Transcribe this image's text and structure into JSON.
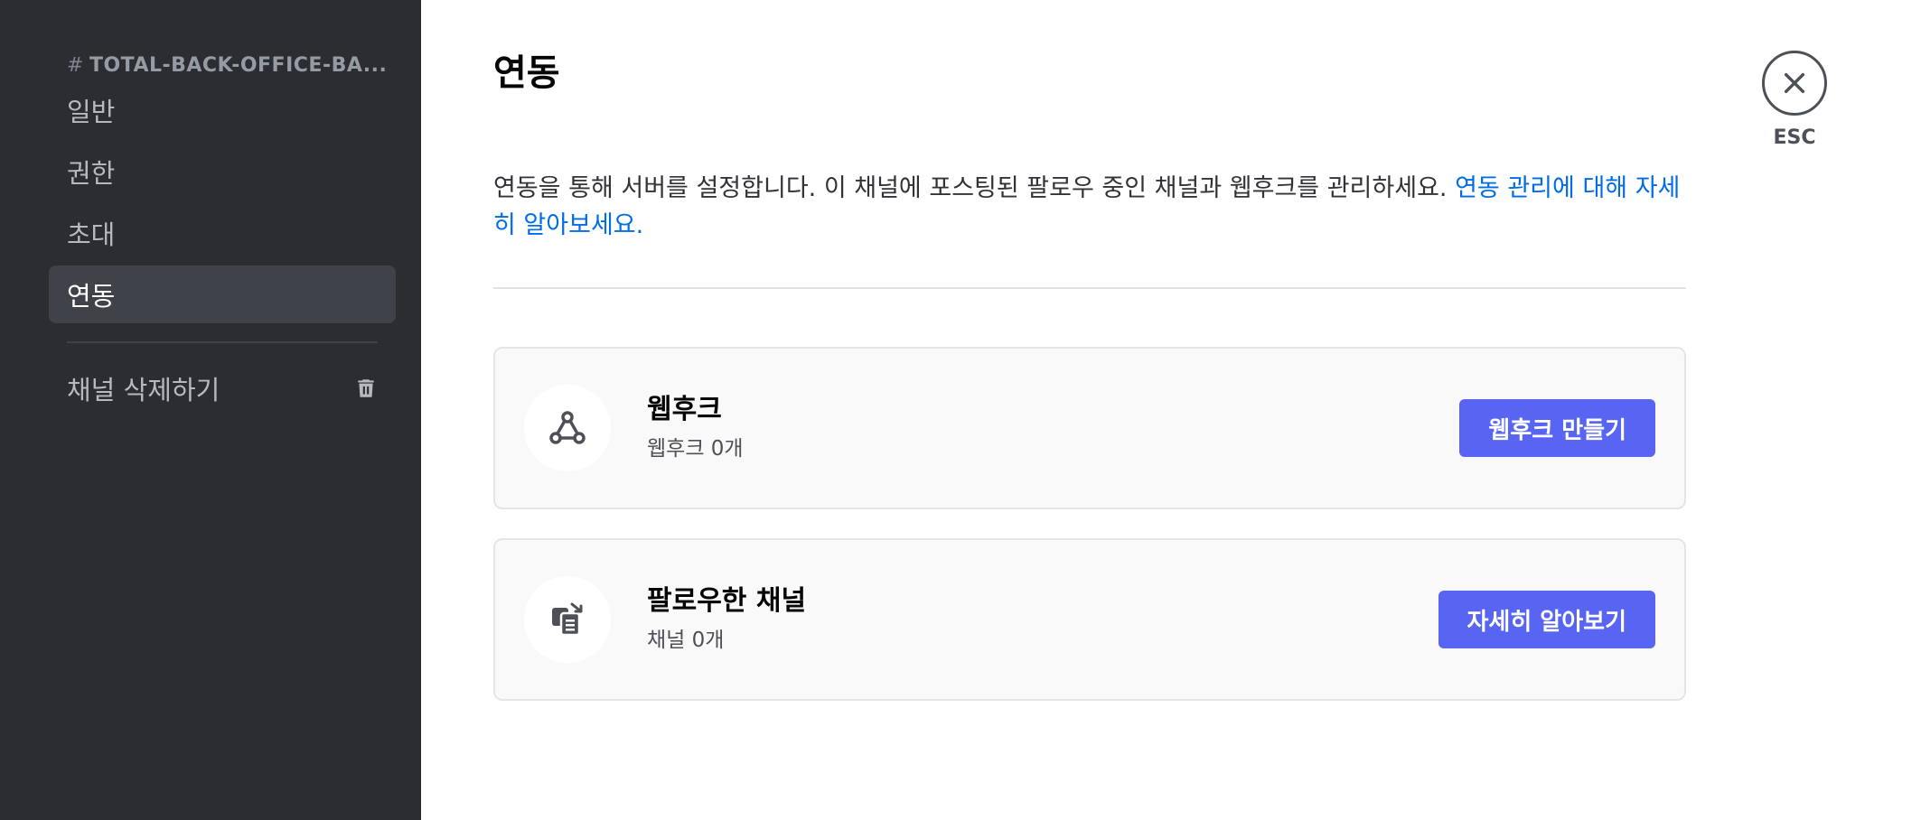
{
  "sidebar": {
    "channel_hash": "#",
    "channel_name": "TOTAL-BACK-OFFICE-BA...",
    "items": [
      {
        "label": "일반"
      },
      {
        "label": "권한"
      },
      {
        "label": "초대"
      },
      {
        "label": "연동"
      }
    ],
    "active_item": "연동",
    "delete_label": "채널 삭제하기",
    "delete_icon": "trash-icon"
  },
  "main": {
    "title": "연동",
    "description": "연동을 통해 서버를 설정합니다. 이 채널에 포스팅된 팔로우 중인 채널과 웹후크를 관리하세요. ",
    "description_link": "연동 관리에 대해 자세히 알아보세요.",
    "cards": [
      {
        "icon": "webhook-icon",
        "title": "웹후크",
        "subtitle": "웹후크 0개",
        "button_label": "웹후크 만들기"
      },
      {
        "icon": "followed-channel-icon",
        "title": "팔로우한 채널",
        "subtitle": "채널 0개",
        "button_label": "자세히 알아보기"
      }
    ]
  },
  "close": {
    "icon": "close-icon",
    "label": "ESC"
  },
  "colors": {
    "sidebar_bg": "#2b2d31",
    "active_item_bg": "#404249",
    "accent": "#5865f2",
    "link": "#006ce7"
  }
}
